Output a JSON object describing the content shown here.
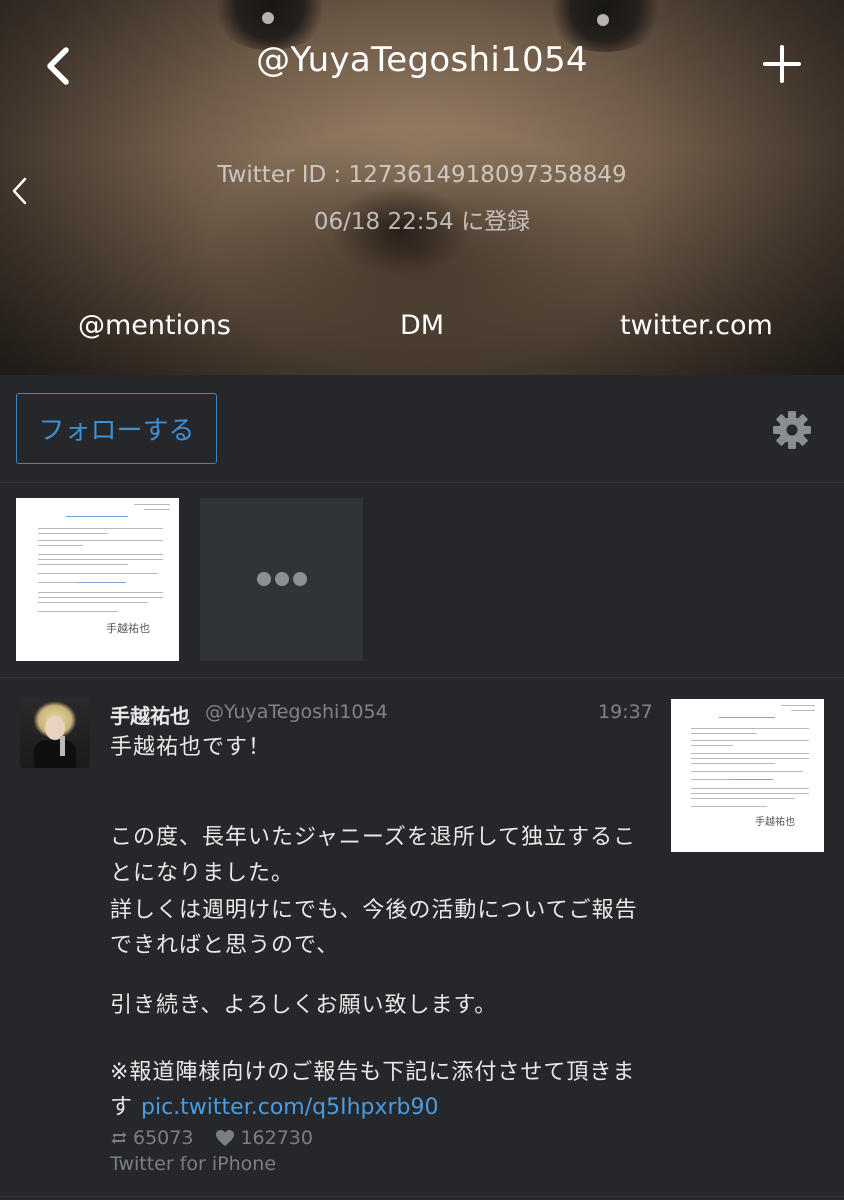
{
  "header": {
    "handle": "@YuyaTegoshi1054",
    "twitter_id": "Twitter ID : 1273614918097358849",
    "registered": "06/18 22:54 に登録",
    "icons": {
      "back": "chevron-left-icon",
      "add": "plus-icon",
      "side": "chevron-left-icon"
    }
  },
  "nav": {
    "mentions": "@mentions",
    "dm": "DM",
    "twitter": "twitter.com"
  },
  "toolbar": {
    "follow_label": "フォローする",
    "settings_icon": "gear-icon",
    "accent_color": "#3f8fd3"
  },
  "media": {
    "doc_signature": "手越祐也",
    "more_icon": "more-dots-icon"
  },
  "tweet": {
    "display_name": "手越祐也",
    "screen_name": "@YuyaTegoshi1054",
    "time": "19:37",
    "lines": [
      "手越祐也です！",
      "この度、長年いたジャニーズを退所して独立するこ",
      "とになりました。",
      "詳しくは週明けにでも、今後の活動についてご報告",
      "できればと思うので、",
      "引き続き、よろしくお願い致します。",
      "※報道陣様向けのご報告も下記に添付させて頂きま",
      "す"
    ],
    "link": "pic.twitter.com/q5Ihpxrb90",
    "retweets": "65073",
    "likes": "162730",
    "source": "Twitter for iPhone",
    "link_color": "#4a9be0"
  }
}
